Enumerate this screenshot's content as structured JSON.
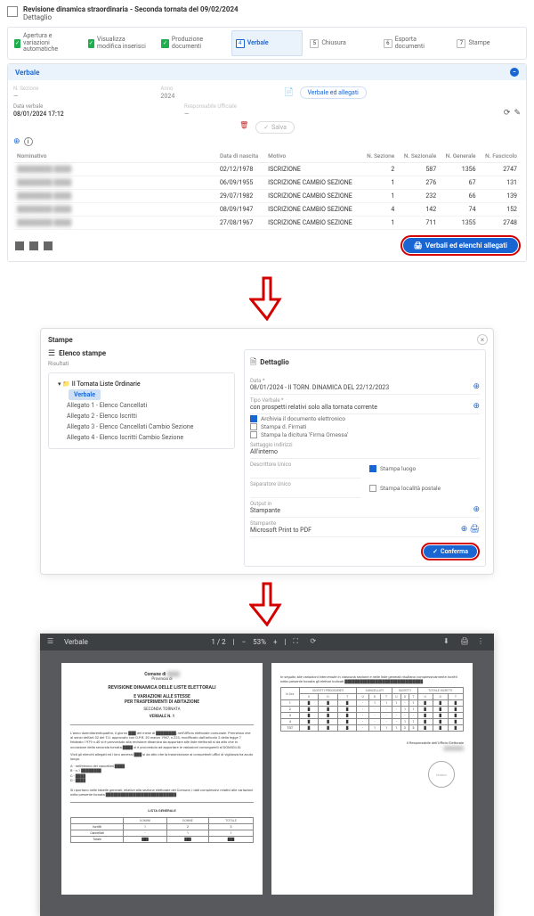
{
  "header": {
    "title": "Revisione dinamica straordinaria - Seconda tornata del 09/02/2024",
    "subtitle": "Dettaglio"
  },
  "steps": [
    {
      "num": "1",
      "label": "Apertura e variazioni automatiche",
      "state": "done"
    },
    {
      "num": "2",
      "label": "Visualizza modifica inserisci",
      "state": "done"
    },
    {
      "num": "3",
      "label": "Produzione documenti",
      "state": "done"
    },
    {
      "num": "4",
      "label": "Verbale",
      "state": "active"
    },
    {
      "num": "5",
      "label": "Chiusura",
      "state": ""
    },
    {
      "num": "6",
      "label": "Esporta documenti",
      "state": ""
    },
    {
      "num": "7",
      "label": "Stampe",
      "state": ""
    }
  ],
  "verbale": {
    "title": "Verbale",
    "sezione": "N. Sezione",
    "anno": {
      "label": "Anno",
      "value": "2024"
    },
    "btn_verbale_allegati": "Verbale ed allegati",
    "data": {
      "label": "Data verbale",
      "value": "08/01/2024 17:12"
    },
    "resp": {
      "label": "Responsabile Ufficiale",
      "value": ""
    },
    "btn_salva": "Salva",
    "table": {
      "headers": {
        "nom": "Nominativo",
        "data": "Data di nascita",
        "motivo": "Motivo",
        "sez": "N. Sezione",
        "nsez": "N. Sezionale",
        "ngen": "N. Generale",
        "nfasc": "N. Fascicolo"
      },
      "rows": [
        {
          "data": "02/12/1978",
          "motivo": "ISCRIZIONE",
          "sez": "2",
          "nsez": "587",
          "ngen": "1356",
          "nfasc": "2747"
        },
        {
          "data": "06/09/1955",
          "motivo": "ISCRIZIONE CAMBIO SEZIONE",
          "sez": "1",
          "nsez": "276",
          "ngen": "67",
          "nfasc": "131"
        },
        {
          "data": "29/07/1982",
          "motivo": "ISCRIZIONE CAMBIO SEZIONE",
          "sez": "1",
          "nsez": "232",
          "ngen": "66",
          "nfasc": "139"
        },
        {
          "data": "08/09/1947",
          "motivo": "ISCRIZIONE CAMBIO SEZIONE",
          "sez": "4",
          "nsez": "142",
          "ngen": "74",
          "nfasc": "152"
        },
        {
          "data": "27/08/1967",
          "motivo": "ISCRIZIONE CAMBIO SEZIONE",
          "sez": "1",
          "nsez": "711",
          "ngen": "1355",
          "nfasc": "2748"
        }
      ]
    },
    "btn_verbali": "Verbali ed elenchi allegati"
  },
  "stampe": {
    "title": "Stampe",
    "elenco": {
      "title": "Elenco stampe",
      "sub": "Risultati"
    },
    "tree": {
      "folder": "II Tornata Liste Ordinarie",
      "items": [
        "Verbale",
        "Allegato 1 - Elenco Cancellati",
        "Allegato 2 - Elenco Iscritti",
        "Allegato 3 - Elenco Cancellati Cambio Sezione",
        "Allegato 4 - Elenco Iscritti Cambio Sezione"
      ]
    },
    "dettaglio": {
      "title": "Dettaglio",
      "data": {
        "label": "Data *",
        "value": "08/01/2024 - II TORN. DINAMICA DEL 22/12/2023"
      },
      "tipo": {
        "label": "Tipo Verbale *",
        "value": "con prospetti relativi solo alla tornata corrente"
      },
      "cb1": "Archivia il documento elettronico",
      "cb2": "Stampa d. Firmati",
      "cb3": "Stampa la dicitura 'Firma Omessa'",
      "indirizzo": {
        "label": "Settaggio indirizzi",
        "value": "All'interno"
      },
      "descr_un": {
        "label": "Descrittore Unico",
        "value": ""
      },
      "stampa_luogo": "Stampa luogo",
      "separatore": {
        "label": "Separatore Unico",
        "value": ""
      },
      "stampa_loc": "Stampa località postale",
      "outputin": {
        "label": "Output in",
        "value": "Stampante"
      },
      "stampante": {
        "label": "Stampante",
        "value": "Microsoft Print to PDF"
      },
      "btn_conferma": "Conferma"
    }
  },
  "pdf": {
    "title": "Verbale",
    "page_ind": "1 / 2",
    "zoom": "53%",
    "doc": {
      "comune": "Comune di",
      "prov": "Provincia di",
      "h1": "REVISIONE DINAMICA DELLE LISTE ELETTORALI",
      "h2": "E VARIAZIONI ALLE STESSE",
      "h3": "PER TRASFERIMENTI DI ABITAZIONE",
      "sub": "SECONDA TORNATA",
      "verb": "VERBALE N. 1"
    }
  }
}
